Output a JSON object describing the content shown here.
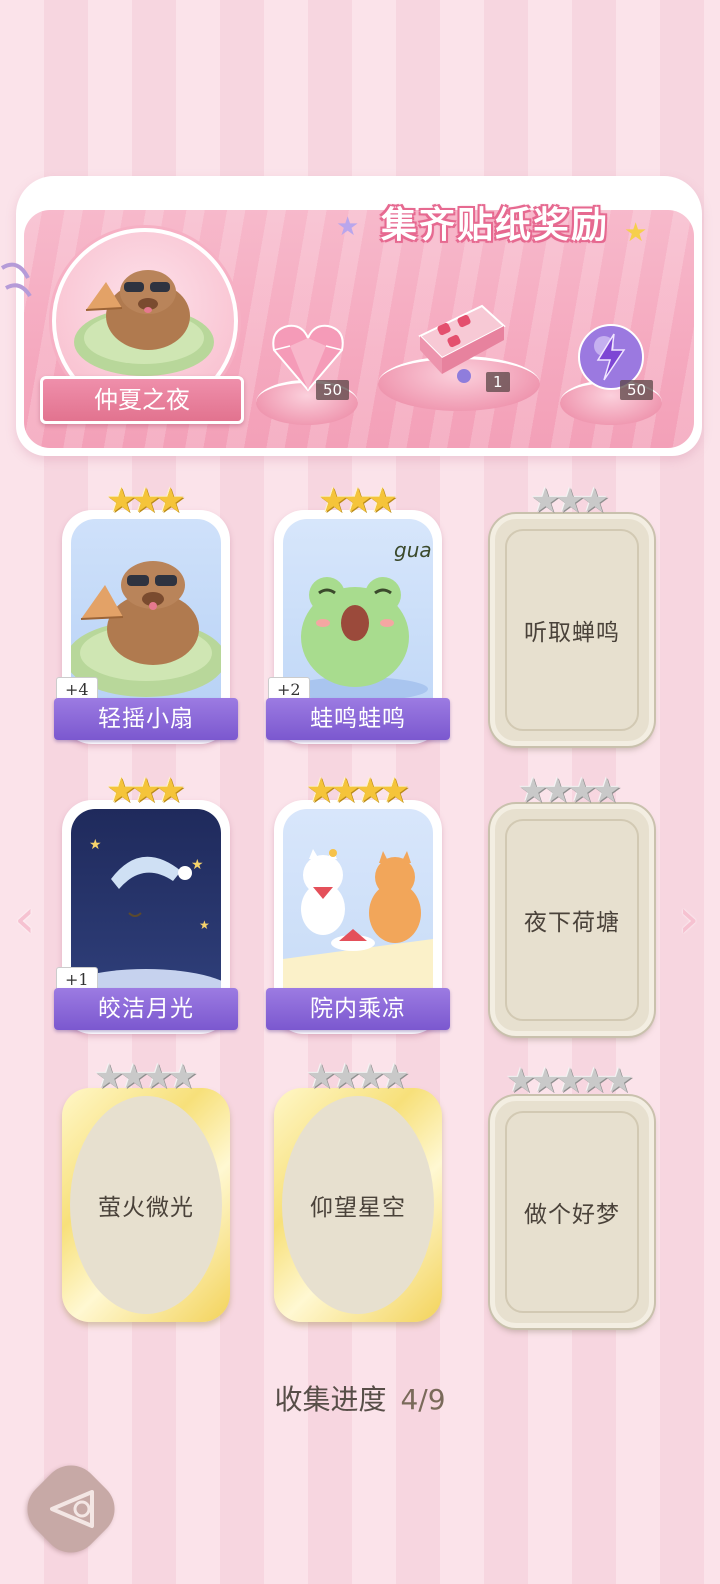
{
  "banner": {
    "title": "集齐贴纸奖励",
    "theme_name": "仲夏之夜",
    "rewards": [
      {
        "icon": "pink-heart-gem-icon",
        "count": "50"
      },
      {
        "icon": "gift-box-icon",
        "count": "1"
      },
      {
        "icon": "purple-lightning-orb-icon",
        "count": "50"
      }
    ]
  },
  "cards": [
    {
      "name": "轻摇小扇",
      "stars": 3,
      "unlocked": true,
      "plus": "+4",
      "art": "capybara-fan"
    },
    {
      "name": "蛙鸣蛙鸣",
      "stars": 3,
      "unlocked": true,
      "plus": "+2",
      "art": "frog-gua",
      "art_text": "gua"
    },
    {
      "name": "听取蝉鸣",
      "stars": 3,
      "unlocked": false
    },
    {
      "name": "皎洁月光",
      "stars": 3,
      "unlocked": true,
      "plus": "+1",
      "art": "sleepy-moon"
    },
    {
      "name": "院内乘凉",
      "stars": 4,
      "unlocked": true,
      "art": "cats-watermelon"
    },
    {
      "name": "夜下荷塘",
      "stars": 4,
      "unlocked": false
    },
    {
      "name": "萤火微光",
      "stars": 4,
      "unlocked": false
    },
    {
      "name": "仰望星空",
      "stars": 4,
      "unlocked": false
    },
    {
      "name": "做个好梦",
      "stars": 5,
      "unlocked": false
    }
  ],
  "progress": {
    "label": "收集进度",
    "value": "4/9"
  },
  "colors": {
    "accent_purple": "#7b58cf",
    "banner_pink": "#f5a9bf",
    "star_gold": "#f5c43a"
  }
}
